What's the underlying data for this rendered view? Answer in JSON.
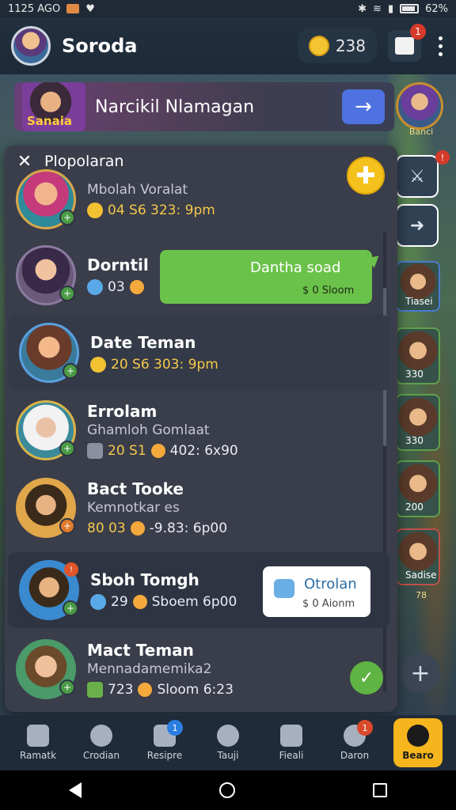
{
  "status_bar": {
    "time": "1125 AGO",
    "battery": "62%"
  },
  "app_bar": {
    "title": "Soroda",
    "coins": "238",
    "gift_badge": "1"
  },
  "promo": {
    "tag": "Sanaia",
    "title": "Narcikil Nlamagan"
  },
  "side_column": [
    {
      "label": "Banci",
      "badge": ""
    },
    {
      "label": "",
      "badge": ""
    },
    {
      "label": "",
      "badge": ""
    },
    {
      "label": "Tiasei",
      "badge": ""
    },
    {
      "label": "330",
      "badge": ""
    },
    {
      "label": "330",
      "badge": ""
    },
    {
      "label": "200",
      "badge": ""
    },
    {
      "label": "Sadise",
      "badge": ""
    },
    {
      "label": "78",
      "badge": ""
    }
  ],
  "panel": {
    "title": "Plopolaran",
    "conversations": [
      {
        "name": "",
        "sub": "Mbolah Voralat",
        "meta": "04 S6 323: 9pm"
      },
      {
        "name": "Dorntil",
        "sub": "",
        "meta": "03"
      },
      {
        "name": "Date Teman",
        "sub": "",
        "meta": "20 S6 303: 9pm"
      },
      {
        "name": "Errolam",
        "sub": "Ghamloh Gomlaat",
        "meta": "20 S1 ",
        "meta2": "402: 6x90"
      },
      {
        "name": "Bact Tooke",
        "sub": "Kemnotkar es",
        "meta": "80 03 ",
        "meta2": "-9.83: 6p00"
      },
      {
        "name": "Sboh Tomgh",
        "sub": "",
        "meta": "29 ",
        "meta2": "Sboem 6p00"
      },
      {
        "name": "Mact Teman",
        "sub": "Mennadamemika2",
        "meta": "723 ",
        "meta2": "Sloom 6:23"
      }
    ],
    "bubble_green": {
      "text": "Dantha soad",
      "meta": "$ 0 Sloom"
    },
    "bubble_white": {
      "text": "Otrolan",
      "meta": "$ 0 Aionm"
    }
  },
  "bottom_nav": [
    {
      "label": "Ramatk",
      "badge": ""
    },
    {
      "label": "Crodian",
      "badge": ""
    },
    {
      "label": "Resipre",
      "badge": "1"
    },
    {
      "label": "Tauji",
      "badge": ""
    },
    {
      "label": "Fieali",
      "badge": ""
    },
    {
      "label": "Daron",
      "badge": "1"
    },
    {
      "label": "Bearo",
      "badge": ""
    }
  ]
}
